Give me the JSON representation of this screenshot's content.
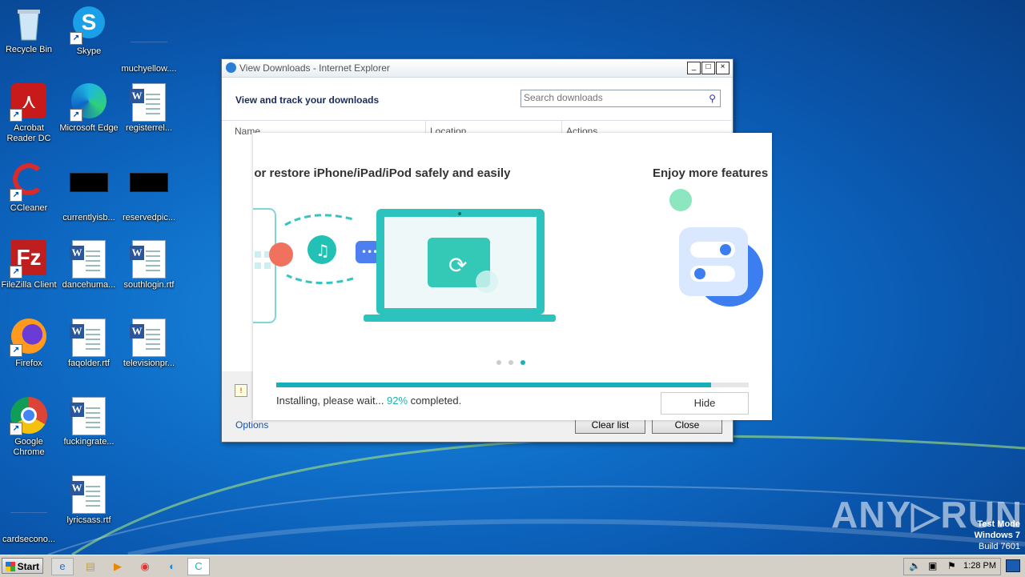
{
  "desktop": {
    "icons": [
      {
        "label": "Recycle Bin"
      },
      {
        "label": "Skype"
      },
      {
        "label": "muchyellow...."
      },
      {
        "label": "Acrobat Reader DC"
      },
      {
        "label": "Microsoft Edge"
      },
      {
        "label": "registerrel..."
      },
      {
        "label": "CCleaner"
      },
      {
        "label": "currentlyisb..."
      },
      {
        "label": "reservedpic..."
      },
      {
        "label": "FileZilla Client"
      },
      {
        "label": "dancehuma..."
      },
      {
        "label": "southlogin.rtf"
      },
      {
        "label": "Firefox"
      },
      {
        "label": "faqolder.rtf"
      },
      {
        "label": "televisionpr..."
      },
      {
        "label": "Google Chrome"
      },
      {
        "label": "fuckingrate..."
      },
      {
        "label": "cardsecono..."
      },
      {
        "label": "lyricsass.rtf"
      }
    ]
  },
  "ie_window": {
    "title": "View Downloads - Internet Explorer",
    "heading": "View and track your downloads",
    "search_placeholder": "Search downloads",
    "columns": [
      "Name",
      "Location",
      "Actions"
    ],
    "options_label": "Options",
    "clear_list_label": "Clear list",
    "close_label": "Close",
    "window_buttons": [
      "_",
      "□",
      "×"
    ]
  },
  "installer": {
    "slide_title_1": "p or restore iPhone/iPad/iPod safely and easily",
    "slide_title_2": "Enjoy more features",
    "progress_percent": 92,
    "status_prefix": "Installing, please wait... ",
    "status_percent": "92%",
    "status_suffix": " completed.",
    "hide_label": "Hide",
    "active_dot": 2
  },
  "taskbar": {
    "start_label": "Start",
    "clock": "1:28 PM"
  },
  "watermark": {
    "brand": "ANY▷RUN",
    "line1": "Test Mode",
    "line2": "Windows 7",
    "line3": "Build 7601"
  },
  "colors": {
    "accent_teal": "#1ab3b3",
    "desktop_blue": "#0f6fc9"
  }
}
